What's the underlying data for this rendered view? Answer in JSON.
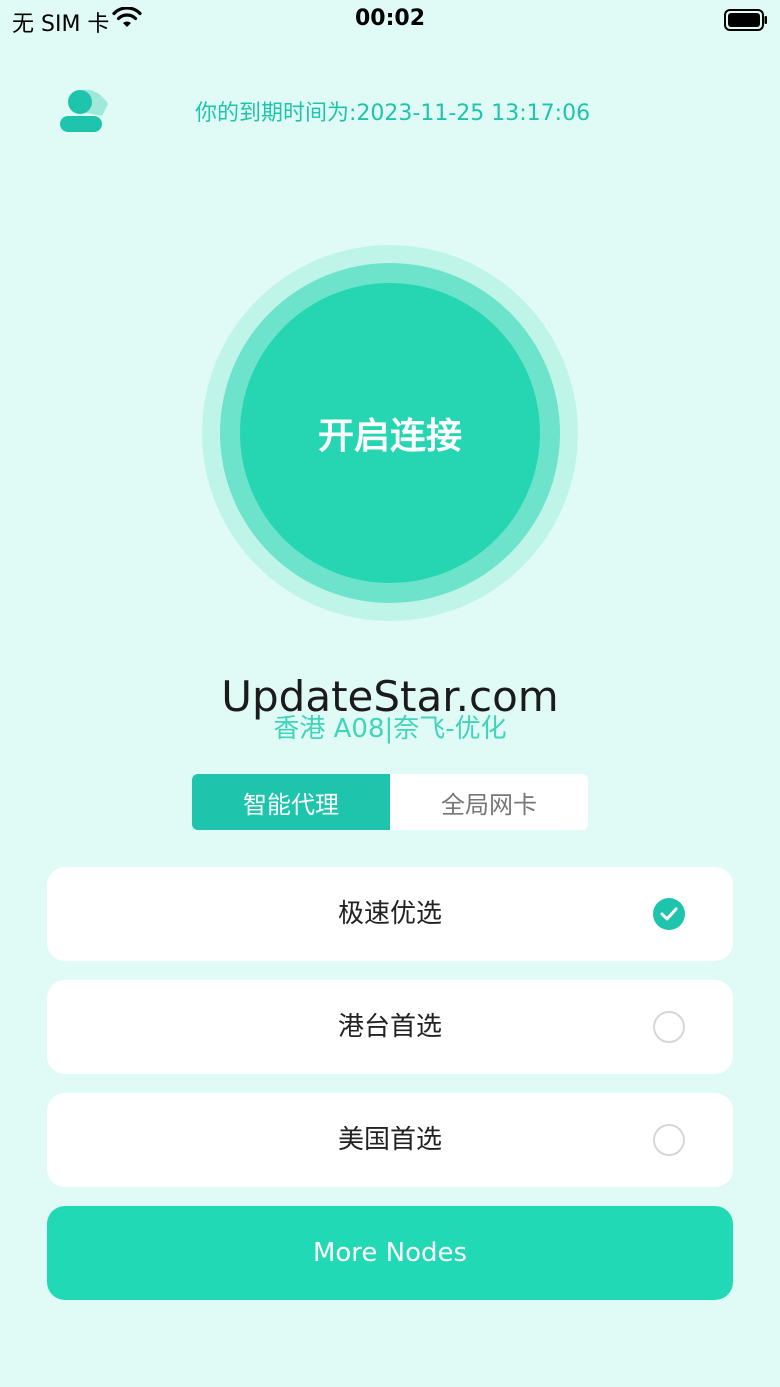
{
  "status_bar": {
    "carrier": "无 SIM 卡",
    "time": "00:02"
  },
  "header": {
    "expiry_text": "你的到期时间为:2023-11-25 13:17:06"
  },
  "connect": {
    "label": "开启连接"
  },
  "watermark": "UpdateStar.com",
  "node": {
    "name": "香港 A08|奈飞-优化"
  },
  "mode_tabs": [
    {
      "label": "智能代理",
      "active": true
    },
    {
      "label": "全局网卡",
      "active": false
    }
  ],
  "options": [
    {
      "label": "极速优选",
      "selected": true
    },
    {
      "label": "港台首选",
      "selected": false
    },
    {
      "label": "美国首选",
      "selected": false
    }
  ],
  "more_button": {
    "label": "More Nodes"
  },
  "colors": {
    "background": "#e0fbf5",
    "accent": "#1fc4ac",
    "button": "#26d6b3"
  }
}
